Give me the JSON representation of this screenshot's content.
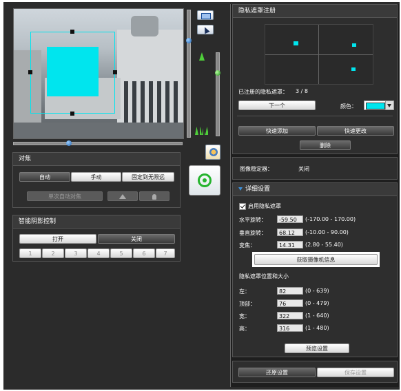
{
  "focus": {
    "title": "对焦",
    "auto_label": "自动",
    "manual_label": "手动",
    "fixed_label": "固定到无限远",
    "one_shot_label": "单次自动对焦"
  },
  "shadow": {
    "title": "智能阴影控制",
    "on_label": "打开",
    "off_label": "关闭",
    "levels": [
      "1",
      "2",
      "3",
      "4",
      "5",
      "6",
      "7"
    ]
  },
  "privacy": {
    "title": "隐私遮罩注册",
    "registered_label": "已注册的隐私遮罩：",
    "registered_count": "3 / 8",
    "next_label": "下一个",
    "color_label": "颜色：",
    "quick_add_label": "快速添加",
    "quick_change_label": "快速更改",
    "delete_label": "删除"
  },
  "stabilizer": {
    "label": "图像稳定器：",
    "value": "关闭"
  },
  "detail": {
    "title": "详细设置",
    "enable_label": "启用隐私遮罩",
    "pan_label": "水平旋转：",
    "pan_value": "-59.50",
    "pan_range": "(-170.00 - 170.00)",
    "tilt_label": "垂直旋转：",
    "tilt_value": "68.12",
    "tilt_range": "(-10.00 - 90.00)",
    "zoom_label": "变焦：",
    "zoom_value": "14.31",
    "zoom_range": "(2.80 - 55.40)",
    "get_info_label": "获取摄像机信息",
    "pos_size_title": "隐私遮罩位置和大小",
    "left_label": "左：",
    "left_value": "82",
    "left_range": "(0 - 639)",
    "top_label": "顶部：",
    "top_value": "76",
    "top_range": "(0 - 479)",
    "width_label": "宽：",
    "width_value": "322",
    "width_range": "(1 - 640)",
    "height_label": "高：",
    "height_value": "316",
    "height_range": "(1 - 480)",
    "preview_label": "预览设置"
  },
  "footer": {
    "restore_label": "还原设置",
    "save_label": "保存设置"
  },
  "colors": {
    "mask": "#00e5ee",
    "accent": "#3d8fd8"
  }
}
